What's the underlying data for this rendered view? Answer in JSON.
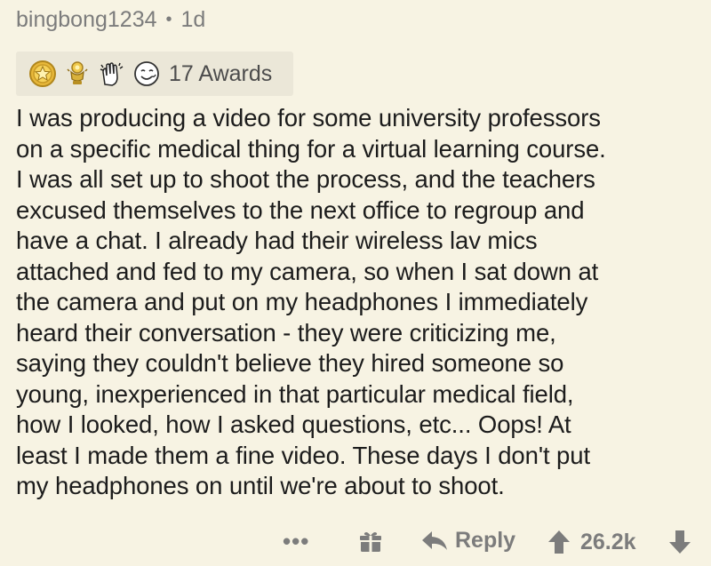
{
  "comment": {
    "username": "bingbong1234",
    "separator": "•",
    "age": "1d",
    "awards": {
      "icons": [
        "gold-star-award-icon",
        "silver-trophy-award-icon",
        "clapping-hands-award-icon",
        "wholesome-face-award-icon"
      ],
      "count_label": "17 Awards"
    },
    "body": "I was producing a video for some university professors\non a specific medical thing for a virtual learning course.\nI was all set up to shoot the process, and the teachers\nexcused themselves to the next office to regroup and\nhave a chat. I already had their wireless lav mics\nattached and fed to my camera, so when I sat down at\nthe camera and put on my headphones I immediately\nheard their conversation - they were criticizing me,\nsaying they couldn't believe they hired someone so\nyoung, inexperienced in that particular medical field,\nhow I looked, how I asked questions, etc... Oops! At\nleast I made them a fine video. These days I don't put\nmy headphones on until we're about to shoot.",
    "footer": {
      "more_label": "•••",
      "reply_label": "Reply",
      "score": "26.2k"
    }
  },
  "colors": {
    "background": "#f7f3e3",
    "award_bar": "#ebe7d8",
    "meta_text": "#7c7c7c",
    "body_text": "#1c1c1c"
  }
}
